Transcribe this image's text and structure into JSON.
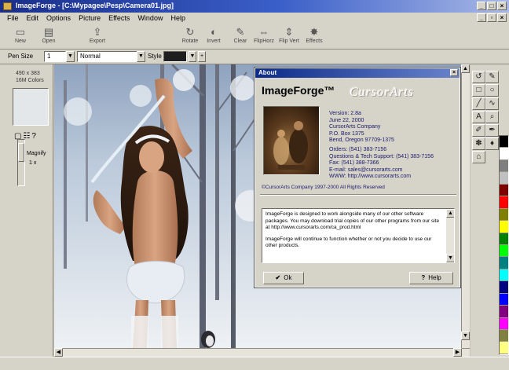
{
  "window": {
    "title": "ImageForge - [C:\\Mypagee\\Pesp\\Camera01.jpg]"
  },
  "menu": {
    "items": [
      "File",
      "Edit",
      "Options",
      "Picture",
      "Effects",
      "Window",
      "Help"
    ]
  },
  "toolbar": {
    "left_tools": [
      {
        "label": "New",
        "icon": "new-file-icon"
      },
      {
        "label": "Open",
        "icon": "open-folder-icon"
      },
      {
        "label": "Export",
        "icon": "export-icon"
      }
    ],
    "right_tools": [
      {
        "label": "Rotate",
        "icon": "rotate-icon"
      },
      {
        "label": "Invert",
        "icon": "invert-icon"
      },
      {
        "label": "Clear",
        "icon": "clear-icon"
      },
      {
        "label": "FlipHorz",
        "icon": "flip-horizontal-icon"
      },
      {
        "label": "Flip Vert",
        "icon": "flip-vertical-icon"
      },
      {
        "label": "Effects",
        "icon": "effects-icon"
      }
    ]
  },
  "pen": {
    "size_label": "Pen Size",
    "size_value": "1",
    "style_value": "Normal",
    "style_label": "Style",
    "swatch_color": "#1e1e1e"
  },
  "left_panel": {
    "dimensions": "490 x 383",
    "colors": "16M Colors",
    "magnify_label": "Magnify",
    "magnify_value": "1 x"
  },
  "about": {
    "title": "About",
    "app_name": "ImageForge™",
    "logo": "CursorArts",
    "info_lines": [
      "Version: 2.8a",
      "June 22, 2000",
      "CursorArts Company",
      "P.O. Box 1375",
      "Bend, Oregon 97709-1375",
      "Orders: (541) 383-7156",
      "Questions & Tech Support: (541) 383-7156",
      "Fax: (541) 388-7366",
      "E-mail: sales@cursorarts.com",
      "WWW: http://www.cursorarts.com"
    ],
    "copyright": "©CursorArts Company 1997-2000 All Rights Reserved",
    "description": [
      "ImageForge is designed to work alongside many of our other software packages. You may download trial copies of our other programs from our site at http://www.cursorarts.com/ca_prod.html",
      "ImageForge will continue to function whether or not you decide to use our other products."
    ],
    "ok_label": "Ok",
    "help_label": "Help"
  },
  "colors": {
    "title_bar": "#1a2e8a",
    "chrome": "#d6d3c9",
    "palette": [
      "#000000",
      "#ffffff",
      "#7f7f7f",
      "#c0c0c0",
      "#800000",
      "#ff0000",
      "#808000",
      "#ffff00",
      "#008000",
      "#00ff00",
      "#008080",
      "#00ffff",
      "#000080",
      "#0000ff",
      "#800080",
      "#ff00ff",
      "#808040",
      "#ffff80"
    ]
  }
}
